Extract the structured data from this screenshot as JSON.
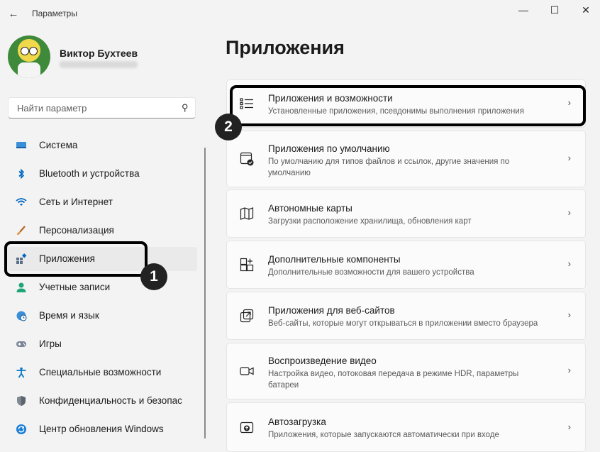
{
  "window": {
    "title": "Параметры",
    "back_icon": "←",
    "minimize_icon": "—",
    "maximize_icon": "☐",
    "close_icon": "✕"
  },
  "profile": {
    "name": "Виктор Бухтеев"
  },
  "search": {
    "placeholder": "Найти параметр",
    "icon": "⚲"
  },
  "sidebar": {
    "items": [
      {
        "label": "Система",
        "icon": "monitor-icon"
      },
      {
        "label": "Bluetooth и устройства",
        "icon": "bluetooth-icon"
      },
      {
        "label": "Сеть и Интернет",
        "icon": "wifi-icon"
      },
      {
        "label": "Персонализация",
        "icon": "brush-icon"
      },
      {
        "label": "Приложения",
        "icon": "apps-icon",
        "selected": true
      },
      {
        "label": "Учетные записи",
        "icon": "person-icon"
      },
      {
        "label": "Время и язык",
        "icon": "globe-clock-icon"
      },
      {
        "label": "Игры",
        "icon": "gamepad-icon"
      },
      {
        "label": "Специальные возможности",
        "icon": "accessibility-icon"
      },
      {
        "label": "Конфиденциальность и безопас",
        "icon": "shield-icon"
      },
      {
        "label": "Центр обновления Windows",
        "icon": "update-icon"
      }
    ]
  },
  "main": {
    "title": "Приложения",
    "chevron": "›",
    "cards": [
      {
        "title": "Приложения и возможности",
        "desc": "Установленные приложения, псевдонимы выполнения приложения",
        "icon": "list-icon"
      },
      {
        "title": "Приложения по умолчанию",
        "desc": "По умолчанию для типов файлов и ссылок, другие значения по умолчанию",
        "icon": "default-apps-icon"
      },
      {
        "title": "Автономные карты",
        "desc": "Загрузки расположение хранилища, обновления карт",
        "icon": "map-icon"
      },
      {
        "title": "Дополнительные компоненты",
        "desc": "Дополнительные возможности для вашего устройства",
        "icon": "components-icon"
      },
      {
        "title": "Приложения для веб-сайтов",
        "desc": "Веб-сайты, которые могут открываться в приложении вместо браузера",
        "icon": "web-apps-icon"
      },
      {
        "title": "Воспроизведение видео",
        "desc": "Настройка видео, потоковая передача в режиме HDR, параметры батареи",
        "icon": "video-icon"
      },
      {
        "title": "Автозагрузка",
        "desc": "Приложения, которые запускаются автоматически при входе",
        "icon": "startup-icon"
      }
    ]
  },
  "annotations": {
    "badge1": "1",
    "badge2": "2"
  },
  "colors": {
    "accent": "#0067c0",
    "highlight": "#000000",
    "badge": "#222222"
  }
}
